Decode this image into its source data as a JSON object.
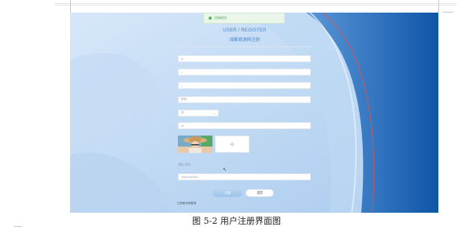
{
  "toast": {
    "text": "注册成功"
  },
  "form": {
    "title_en": "USER / REGISTER",
    "title_cn": "成都旅游网注册",
    "fields": [
      {
        "value": "ld"
      },
      {
        "value": "•"
      },
      {
        "value": "•"
      },
      {
        "value": "李明"
      }
    ],
    "gender_select": {
      "value": "男"
    },
    "age_field": {
      "value": "20"
    },
    "upload": {
      "plus": "+"
    },
    "signature_label": "请输入签名",
    "phone_field": {
      "value": "19800000000"
    },
    "buttons": {
      "submit": "注册",
      "reset": "重置"
    },
    "login_link": "已有账号请登录"
  },
  "caption": "图 5-2 用户注册界面图",
  "colors": {
    "accent": "#4b86c6",
    "panel_blue": "#0f56a8",
    "red_stroke": "#e0524b"
  }
}
